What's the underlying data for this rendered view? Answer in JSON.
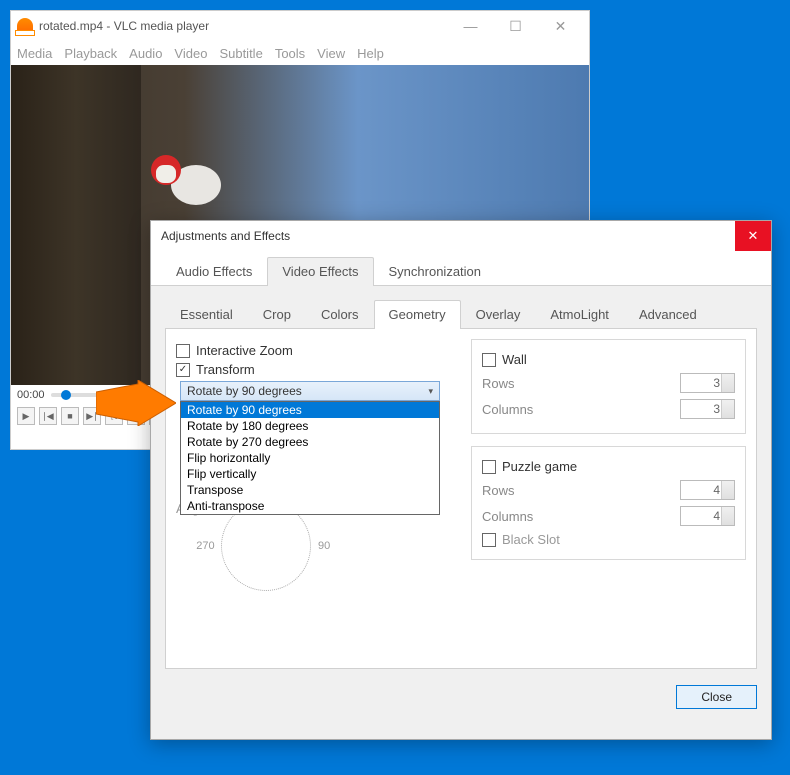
{
  "vlc": {
    "title": "rotated.mp4 - VLC media player",
    "menu": [
      "Media",
      "Playback",
      "Audio",
      "Video",
      "Subtitle",
      "Tools",
      "View",
      "Help"
    ],
    "time": "00:00"
  },
  "fx": {
    "title": "Adjustments and Effects",
    "tabs": {
      "audio": "Audio Effects",
      "video": "Video Effects",
      "sync": "Synchronization"
    },
    "subtabs": {
      "essential": "Essential",
      "crop": "Crop",
      "colors": "Colors",
      "geometry": "Geometry",
      "overlay": "Overlay",
      "atmo": "AtmoLight",
      "advanced": "Advanced"
    },
    "geometry": {
      "interactive_zoom": "Interactive Zoom",
      "transform": "Transform",
      "transform_selected": "Rotate by 90 degrees",
      "options": [
        "Rotate by 90 degrees",
        "Rotate by 180 degrees",
        "Rotate by 270 degrees",
        "Flip horizontally",
        "Flip vertically",
        "Transpose",
        "Anti-transpose"
      ],
      "angle": "Angle",
      "wall": "Wall",
      "rows_label": "Rows",
      "columns_label": "Columns",
      "wall_rows": "3",
      "wall_cols": "3",
      "puzzle": "Puzzle game",
      "puzzle_rows": "4",
      "puzzle_cols": "4",
      "black_slot": "Black Slot",
      "dial_270": "270",
      "dial_90": "90"
    },
    "close": "Close"
  }
}
